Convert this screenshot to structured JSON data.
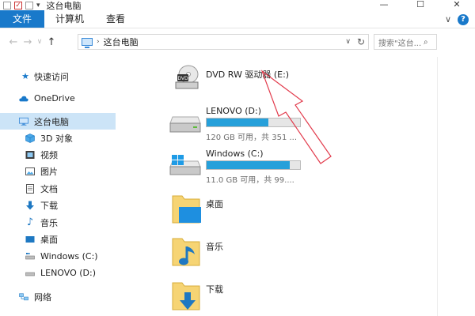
{
  "window": {
    "title": "这台电脑",
    "controls": {
      "minimize": "—",
      "maximize": "☐",
      "close": "✕"
    }
  },
  "quick_access_toolbar": {
    "dropdown": "▾"
  },
  "ribbon": {
    "tabs": [
      {
        "label": "文件"
      },
      {
        "label": "计算机"
      },
      {
        "label": "查看"
      }
    ],
    "expand": "∨",
    "help": "?"
  },
  "navigation": {
    "back": "←",
    "forward": "→",
    "recent": "∨",
    "up": "↑",
    "breadcrumb_sep": "›",
    "breadcrumb": "这台电脑",
    "address_dropdown": "∨",
    "refresh": "↻",
    "search_placeholder": "搜索\"这台...",
    "search_icon": "⌕"
  },
  "sidebar": {
    "items": [
      {
        "label": "快速访问",
        "icon": "star-icon"
      },
      {
        "label": "OneDrive",
        "icon": "cloud-icon"
      },
      {
        "label": "这台电脑",
        "icon": "computer-icon",
        "selected": true
      },
      {
        "label": "3D 对象",
        "icon": "cube-icon"
      },
      {
        "label": "视频",
        "icon": "video-icon"
      },
      {
        "label": "图片",
        "icon": "picture-icon"
      },
      {
        "label": "文档",
        "icon": "document-icon"
      },
      {
        "label": "下载",
        "icon": "download-icon"
      },
      {
        "label": "音乐",
        "icon": "music-icon"
      },
      {
        "label": "桌面",
        "icon": "desktop-icon"
      },
      {
        "label": "Windows (C:)",
        "icon": "drive-icon"
      },
      {
        "label": "LENOVO (D:)",
        "icon": "drive-icon"
      },
      {
        "label": "网络",
        "icon": "network-icon"
      }
    ]
  },
  "drives": [
    {
      "name": "DVD RW 驱动器 (E:)",
      "icon": "dvd-drive-icon",
      "icon_label": "DVD"
    },
    {
      "name": "LENOVO (D:)",
      "icon": "hard-drive-icon",
      "info": "120 GB 可用，共 351 ...",
      "fill": 0.66
    },
    {
      "name": "Windows (C:)",
      "icon": "windows-drive-icon",
      "info": "11.0 GB 可用，共 99....",
      "fill": 0.89
    }
  ],
  "folders": [
    {
      "label": "桌面",
      "icon": "desktop-folder-icon"
    },
    {
      "label": "音乐",
      "icon": "music-folder-icon"
    },
    {
      "label": "下载",
      "icon": "download-folder-icon"
    }
  ],
  "colors": {
    "accent": "#1979ca",
    "selection": "#cce4f7",
    "drive_bar": "#26a0da",
    "arrow": "#e23b4c"
  }
}
